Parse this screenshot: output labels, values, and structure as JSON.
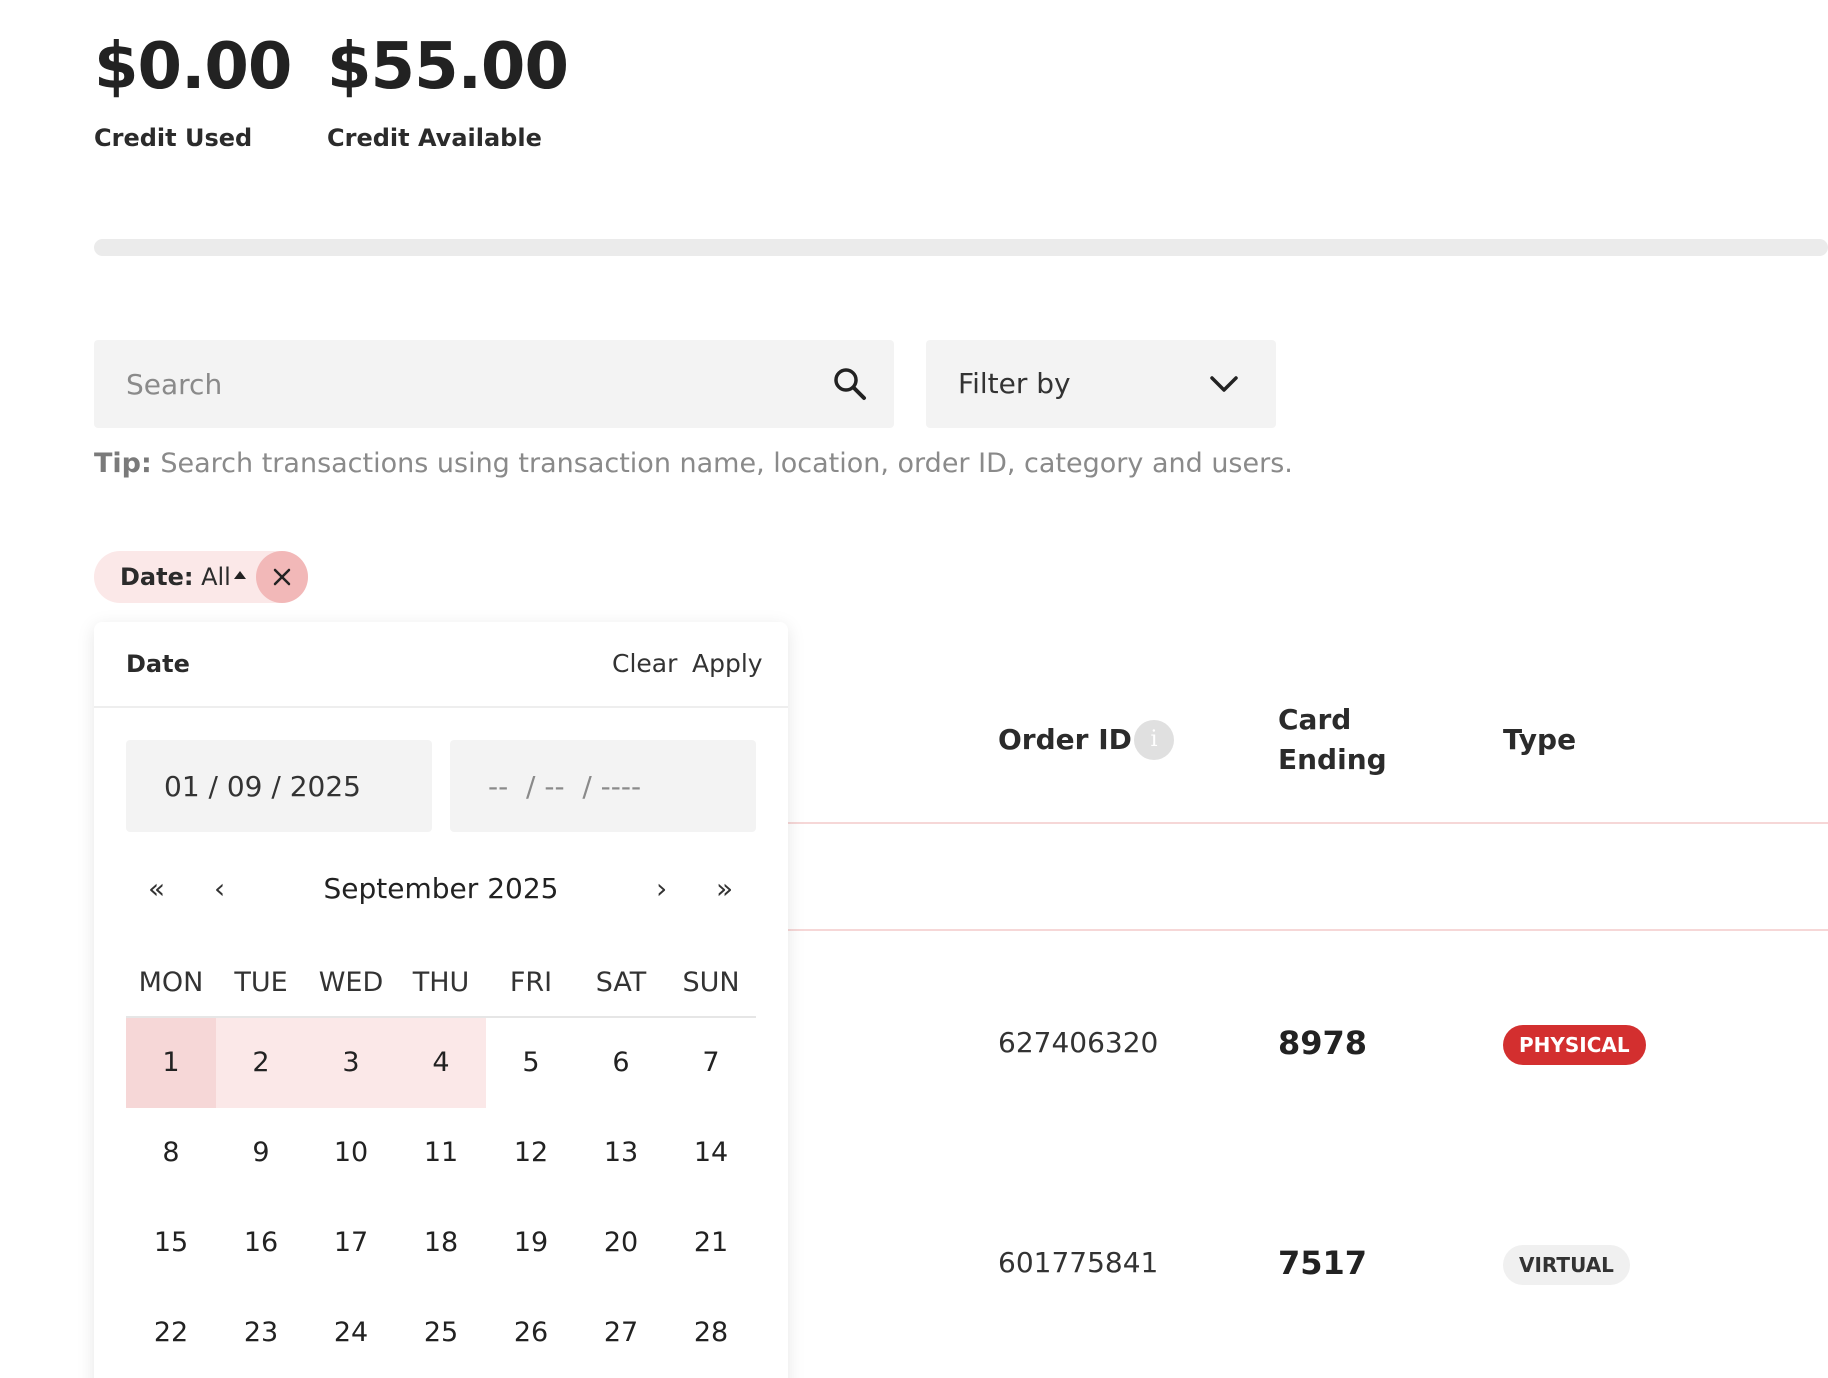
{
  "summary": {
    "credit_used_amount": "$0.00",
    "credit_used_label": "Credit Used",
    "credit_available_amount": "$55.00",
    "credit_available_label": "Credit Available",
    "usage_fraction": 0.0
  },
  "search": {
    "placeholder": "Search",
    "icon": "search-icon"
  },
  "filter": {
    "label": "Filter by",
    "icon": "chevron-down-icon"
  },
  "tip": {
    "prefix": "Tip:",
    "text": " Search transactions using transaction name, location, order ID, category and users."
  },
  "chip": {
    "key": "Date:",
    "value": " All"
  },
  "table": {
    "columns": {
      "order_id": "Order ID",
      "card_line1": "Card",
      "card_line2": "Ending",
      "type": "Type"
    },
    "rows": [
      {
        "order_id": "627406320",
        "card": "8978",
        "type": "PHYSICAL"
      },
      {
        "order_id": "601775841",
        "card": "7517",
        "type": "VIRTUAL"
      }
    ]
  },
  "datepicker": {
    "title": "Date",
    "clear": "Clear",
    "apply": "Apply",
    "start": "01 / 09 / 2025",
    "end": "--  / --  / ----",
    "month_label": "September 2025",
    "nav": {
      "prev_year": "«",
      "prev_month": "‹",
      "next_month": "›",
      "next_year": "»"
    },
    "weekdays": [
      "MON",
      "TUE",
      "WED",
      "THU",
      "FRI",
      "SAT",
      "SUN"
    ],
    "weeks": [
      [
        "1",
        "2",
        "3",
        "4",
        "5",
        "6",
        "7"
      ],
      [
        "8",
        "9",
        "10",
        "11",
        "12",
        "13",
        "14"
      ],
      [
        "15",
        "16",
        "17",
        "18",
        "19",
        "20",
        "21"
      ],
      [
        "22",
        "23",
        "24",
        "25",
        "26",
        "27",
        "28"
      ]
    ],
    "selected_day": "1",
    "range_days": [
      "2",
      "3",
      "4"
    ]
  },
  "colors": {
    "accent": "#d32f2f",
    "selected_bg": "#f6d7d7",
    "range_bg": "#fbe8e8"
  }
}
